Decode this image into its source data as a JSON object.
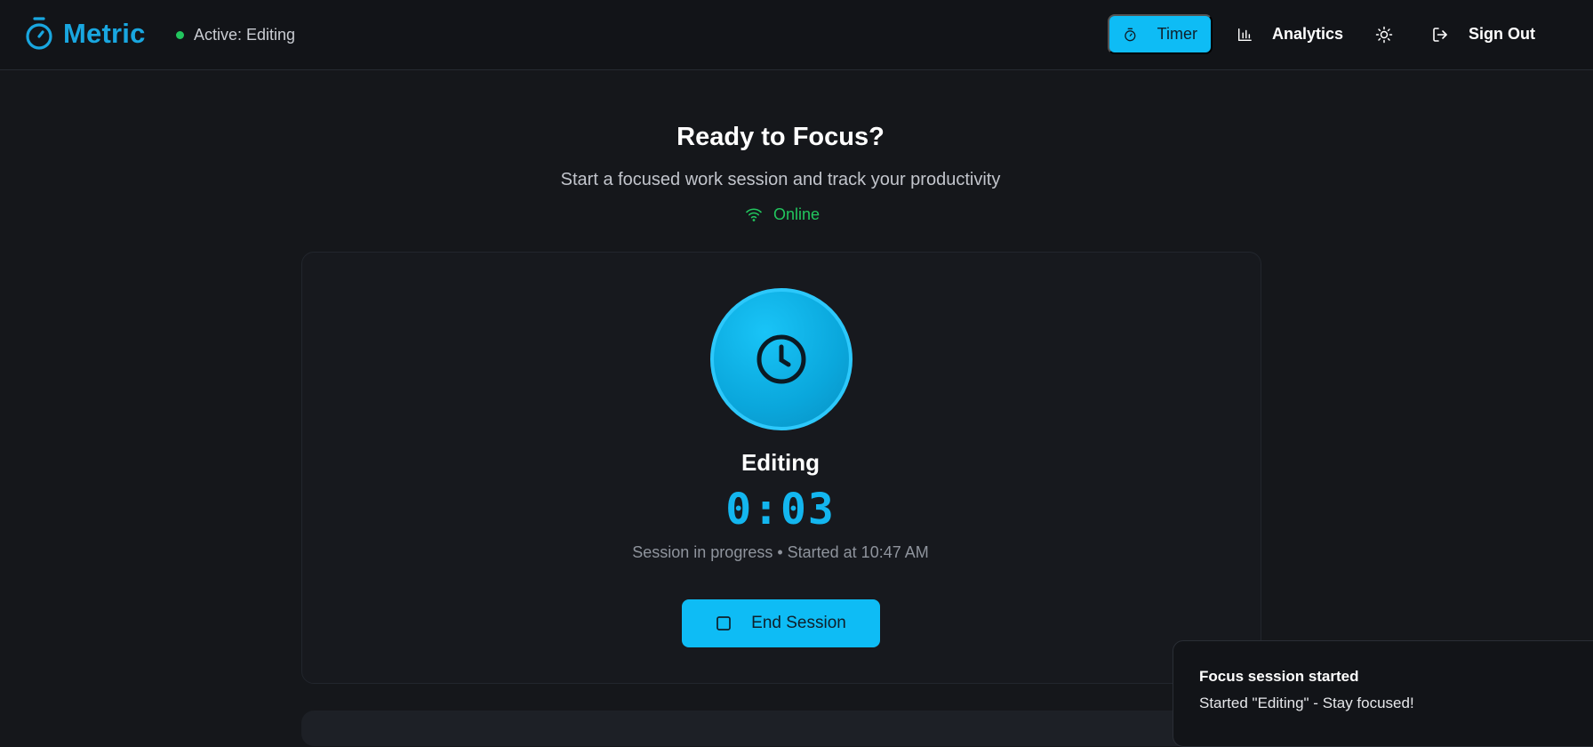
{
  "header": {
    "brand": "Metric",
    "active_status": "Active: Editing",
    "nav": {
      "timer": "Timer",
      "analytics": "Analytics",
      "sign_out": "Sign Out"
    }
  },
  "hero": {
    "title": "Ready to Focus?",
    "subtitle": "Start a focused work session and track your productivity",
    "connection": "Online"
  },
  "session": {
    "activity": "Editing",
    "elapsed": "0:03",
    "status": "Session in progress • Started at 10:47 AM",
    "end_button": "End Session"
  },
  "toast": {
    "title": "Focus session started",
    "message": "Started \"Editing\" - Stay focused!"
  },
  "icons": {
    "brand": "stopwatch-icon",
    "timer": "stopwatch-icon",
    "analytics": "bar-chart-icon",
    "theme": "sun-icon",
    "sign_out": "log-out-icon",
    "online": "wifi-icon",
    "orb": "clock-icon",
    "end": "stop-square-icon"
  },
  "colors": {
    "accent": "#0ebcf5",
    "brand": "#19a7e0",
    "online": "#22c55e",
    "background": "#15171b"
  }
}
